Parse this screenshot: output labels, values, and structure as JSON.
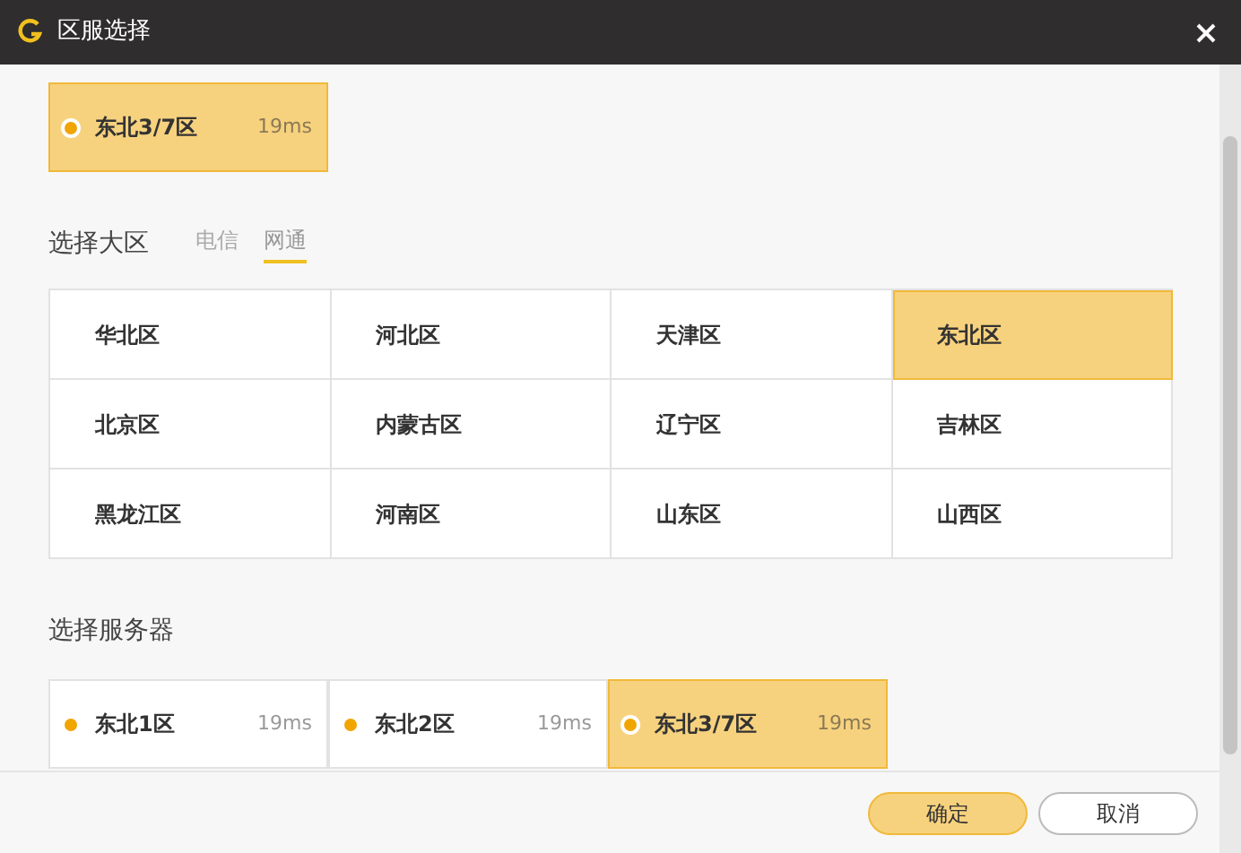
{
  "window": {
    "title": "区服选择"
  },
  "current_server": {
    "name": "东北3/7区",
    "ping": "19ms"
  },
  "region_section": {
    "label": "选择大区",
    "tabs": [
      {
        "label": "电信",
        "selected": false
      },
      {
        "label": "网通",
        "selected": true
      }
    ],
    "regions": [
      {
        "name": "华北区",
        "selected": false
      },
      {
        "name": "河北区",
        "selected": false
      },
      {
        "name": "天津区",
        "selected": false
      },
      {
        "name": "东北区",
        "selected": true
      },
      {
        "name": "北京区",
        "selected": false
      },
      {
        "name": "内蒙古区",
        "selected": false
      },
      {
        "name": "辽宁区",
        "selected": false
      },
      {
        "name": "吉林区",
        "selected": false
      },
      {
        "name": "黑龙江区",
        "selected": false
      },
      {
        "name": "河南区",
        "selected": false
      },
      {
        "name": "山东区",
        "selected": false
      },
      {
        "name": "山西区",
        "selected": false
      }
    ]
  },
  "server_section": {
    "label": "选择服务器",
    "servers": [
      {
        "name": "东北1区",
        "ping": "19ms",
        "selected": false
      },
      {
        "name": "东北2区",
        "ping": "19ms",
        "selected": false
      },
      {
        "name": "东北3/7区",
        "ping": "19ms",
        "selected": true
      }
    ]
  },
  "buttons": [
    {
      "label": "确定",
      "kind": "primary"
    },
    {
      "label": "取消",
      "kind": "secondary"
    }
  ]
}
